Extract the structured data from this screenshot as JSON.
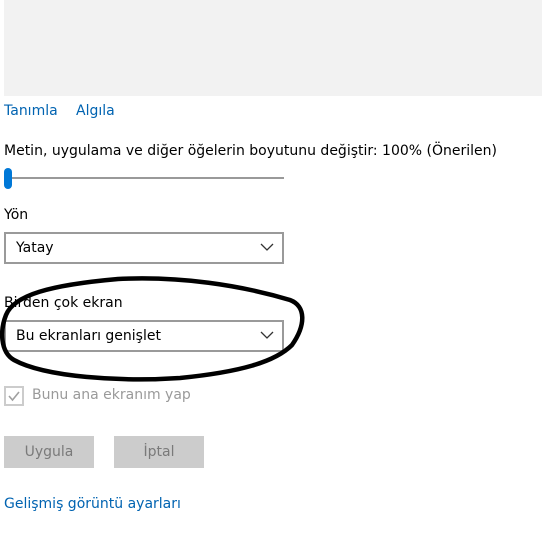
{
  "links": {
    "identify": "Tanımla",
    "detect": "Algıla",
    "advanced": "Gelişmiş görüntü ayarları"
  },
  "scale": {
    "label": "Metin, uygulama ve diğer öğelerin boyutunu değiştir: 100% (Önerilen)",
    "slider_level": 0
  },
  "orientation": {
    "label": "Yön",
    "value": "Yatay"
  },
  "multiple_displays": {
    "label": "Birden çok ekran",
    "value": "Bu ekranları genişlet"
  },
  "main_display": {
    "label": "Bunu ana ekranım yap",
    "checked": true,
    "enabled": false
  },
  "buttons": {
    "apply": "Uygula",
    "cancel": "İptal"
  },
  "colors": {
    "link": "#0063b1",
    "accent": "#0078d7",
    "disabled_text": "#9a9a9a",
    "disabled_button": "#cccccc",
    "annotation": "#000000"
  },
  "icons": {
    "dropdown": "chevron-down-icon",
    "checkbox": "checkmark-icon"
  }
}
